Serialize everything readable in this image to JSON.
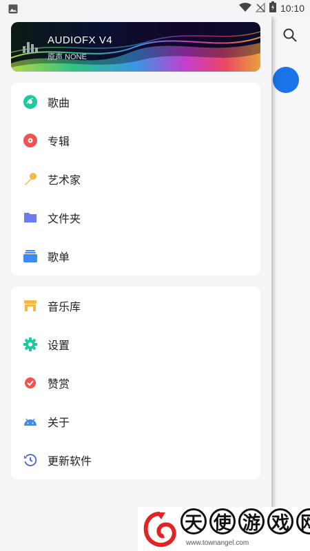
{
  "status_bar": {
    "time": "10:10",
    "icons": [
      "image-icon",
      "wifi-icon",
      "no-signal-icon",
      "battery-charging-icon"
    ]
  },
  "background_app": {
    "icons": [
      "search-icon"
    ],
    "accent_color": "#1a73e8"
  },
  "drawer": {
    "banner": {
      "title": "AUDIOFX V4",
      "subtitle": "原声 NONE"
    },
    "section1": [
      {
        "label": "歌曲",
        "icon": "song-disc-icon",
        "color": "#1ec8a0"
      },
      {
        "label": "专辑",
        "icon": "album-disc-icon",
        "color": "#ef5350"
      },
      {
        "label": "艺术家",
        "icon": "microphone-icon",
        "color": "#f5b942"
      },
      {
        "label": "文件夹",
        "icon": "folder-icon",
        "color": "#6b7cf0"
      },
      {
        "label": "歌单",
        "icon": "playlist-icon",
        "color": "#3d8bf2"
      }
    ],
    "section2": [
      {
        "label": "音乐库",
        "icon": "store-icon",
        "color": "#f5b942"
      },
      {
        "label": "设置",
        "icon": "gear-icon",
        "color": "#1ec8a0"
      },
      {
        "label": "赞赏",
        "icon": "badge-check-icon",
        "color": "#ef5350"
      },
      {
        "label": "关于",
        "icon": "android-icon",
        "color": "#3d8bf2"
      },
      {
        "label": "更新软件",
        "icon": "update-clock-icon",
        "color": "#5b6bd6"
      }
    ]
  },
  "watermark": {
    "chars": [
      "天",
      "使",
      "游",
      "戏",
      "网"
    ],
    "url": "www.townangel.com"
  }
}
